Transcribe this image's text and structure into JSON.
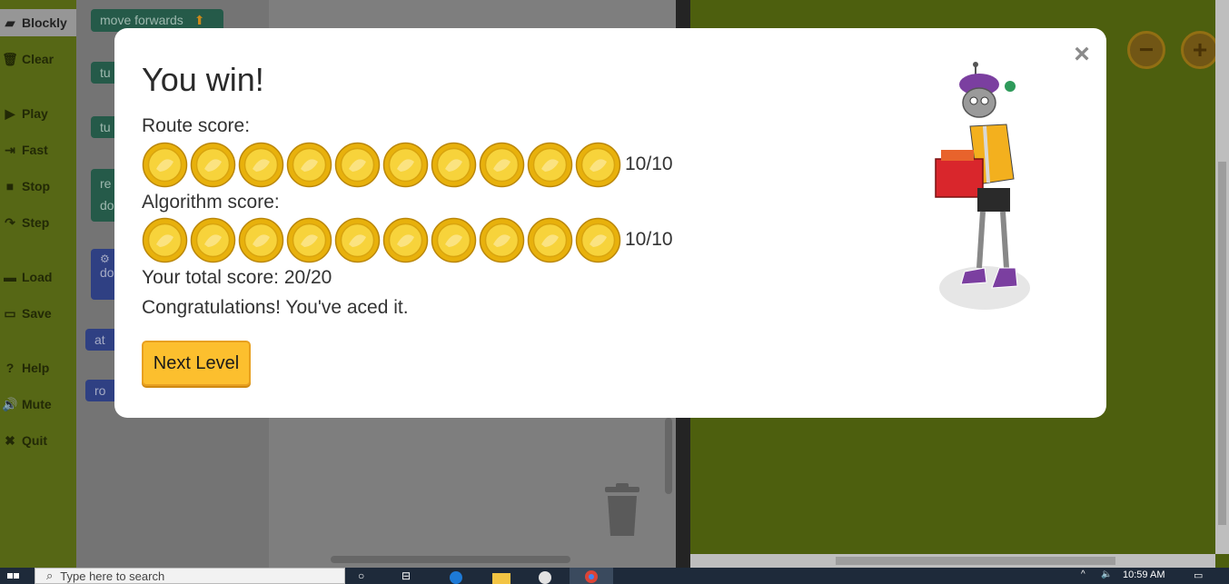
{
  "sidebar": {
    "items": [
      {
        "label": "Blockly",
        "icon": "blockly-icon",
        "glyph": "▰"
      },
      {
        "label": "Clear",
        "icon": "trash-icon",
        "glyph": "🗑"
      },
      {
        "label": "Play",
        "icon": "play-icon",
        "glyph": "▶"
      },
      {
        "label": "Fast",
        "icon": "fast-forward-icon",
        "glyph": "⇥"
      },
      {
        "label": "Stop",
        "icon": "stop-icon",
        "glyph": "■"
      },
      {
        "label": "Step",
        "icon": "step-icon",
        "glyph": "↷"
      },
      {
        "label": "Load",
        "icon": "folder-icon",
        "glyph": "▬"
      },
      {
        "label": "Save",
        "icon": "save-icon",
        "glyph": "▭"
      },
      {
        "label": "Help",
        "icon": "help-icon",
        "glyph": "?"
      },
      {
        "label": "Mute",
        "icon": "speaker-icon",
        "glyph": "🔊"
      },
      {
        "label": "Quit",
        "icon": "close-icon",
        "glyph": "✖"
      }
    ]
  },
  "toolbox": {
    "blocks": [
      {
        "label": "move forwards"
      },
      {
        "label": "tu"
      },
      {
        "label": "tu"
      },
      {
        "label": "re"
      },
      {
        "label": "do"
      },
      {
        "label": "do"
      },
      {
        "label": "at"
      },
      {
        "label": "ro"
      }
    ]
  },
  "modal": {
    "title": "You win!",
    "close_glyph": "×",
    "route_label": "Route score:",
    "route_score": "10/10",
    "route_coins": 10,
    "algorithm_label": "Algorithm score:",
    "algorithm_score": "10/10",
    "algorithm_coins": 10,
    "total": "Your total score: 20/20",
    "message": "Congratulations! You've aced it.",
    "next_button": "Next Level"
  },
  "map": {
    "zoom_out": "−",
    "zoom_in": "+"
  },
  "taskbar": {
    "search_placeholder": "Type here to search",
    "clock": "10:59 AM"
  },
  "colors": {
    "accent_button": "#fcbf2e",
    "coin": "#f5c518",
    "map_background": "#5e7412"
  }
}
